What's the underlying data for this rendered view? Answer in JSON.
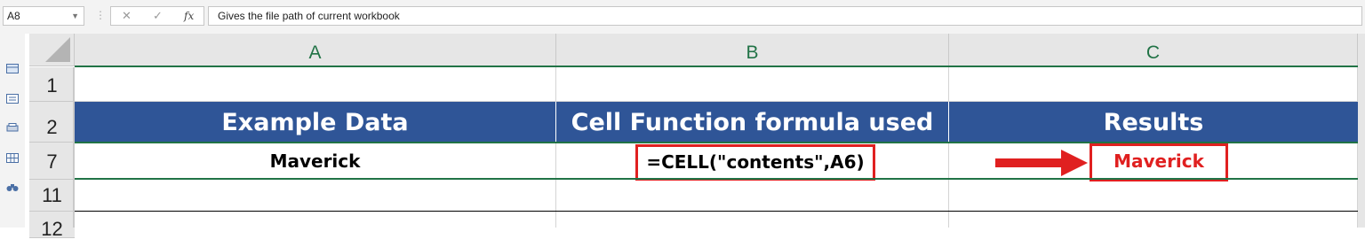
{
  "formula_bar": {
    "name_box": "A8",
    "formula_text": "Gives the file path of current workbook",
    "fx_label": "fx",
    "cancel_glyph": "✕",
    "enter_glyph": "✓"
  },
  "columns": [
    "A",
    "B",
    "C"
  ],
  "rows": [
    "1",
    "2",
    "7",
    "11",
    "12"
  ],
  "table": {
    "headers": [
      "Example Data",
      "Cell Function formula used",
      "Results"
    ],
    "row7": {
      "example": "Maverick",
      "formula": "=CELL(\"contents\",A6)",
      "result": "Maverick"
    }
  },
  "colors": {
    "header_fill": "#2f5597",
    "highlight_red": "#e02020",
    "excel_green": "#217346"
  },
  "icons": [
    "dropdown-icon",
    "cancel-icon",
    "enter-icon",
    "fx-icon",
    "arrow-right-icon"
  ]
}
